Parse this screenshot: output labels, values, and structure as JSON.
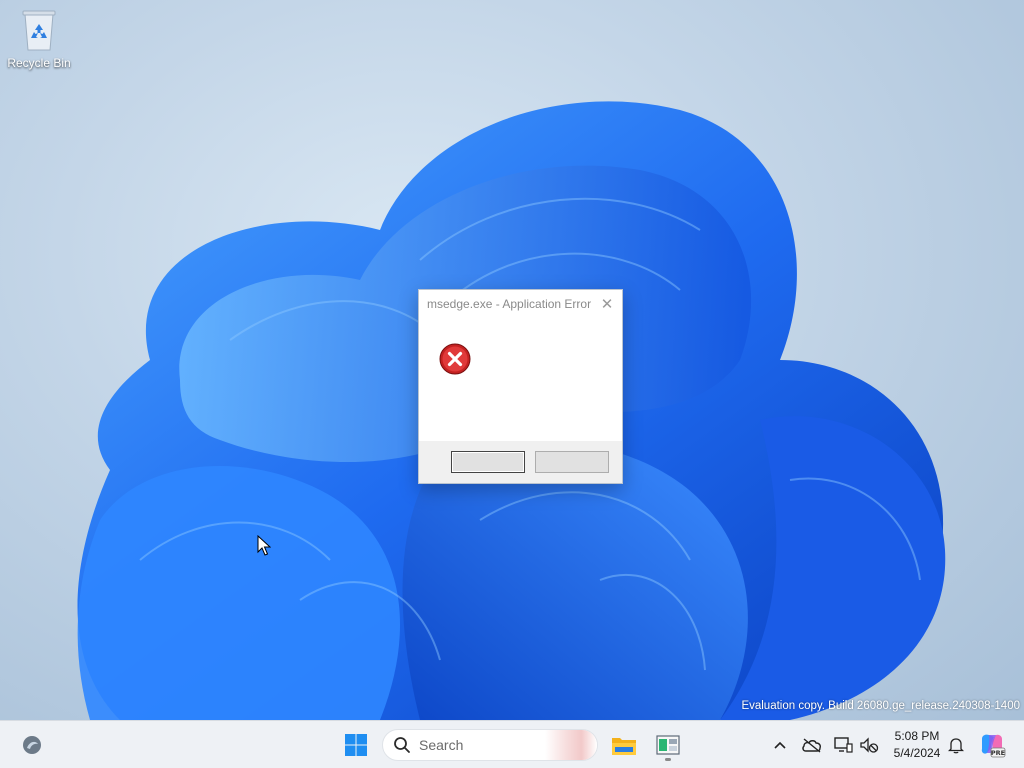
{
  "desktop": {
    "icons": [
      {
        "label": "Recycle Bin"
      }
    ],
    "watermark": "Evaluation copy. Build 26080.ge_release.240308-1400"
  },
  "dialog": {
    "title": "msedge.exe - Application Error",
    "close_glyph": "✕",
    "icon": "error-icon",
    "buttons": [
      {
        "label": ""
      },
      {
        "label": ""
      }
    ]
  },
  "taskbar": {
    "search_placeholder": "Search",
    "time": "5:08 PM",
    "date": "5/4/2024",
    "copilot_badge": "PRE",
    "apps": [
      "widgets-icon",
      "start-icon",
      "file-explorer-icon",
      "app-icon"
    ]
  },
  "colors": {
    "accent": "#0067c0",
    "error": "#d42d2d",
    "taskbar_bg": "#eef1f5"
  }
}
